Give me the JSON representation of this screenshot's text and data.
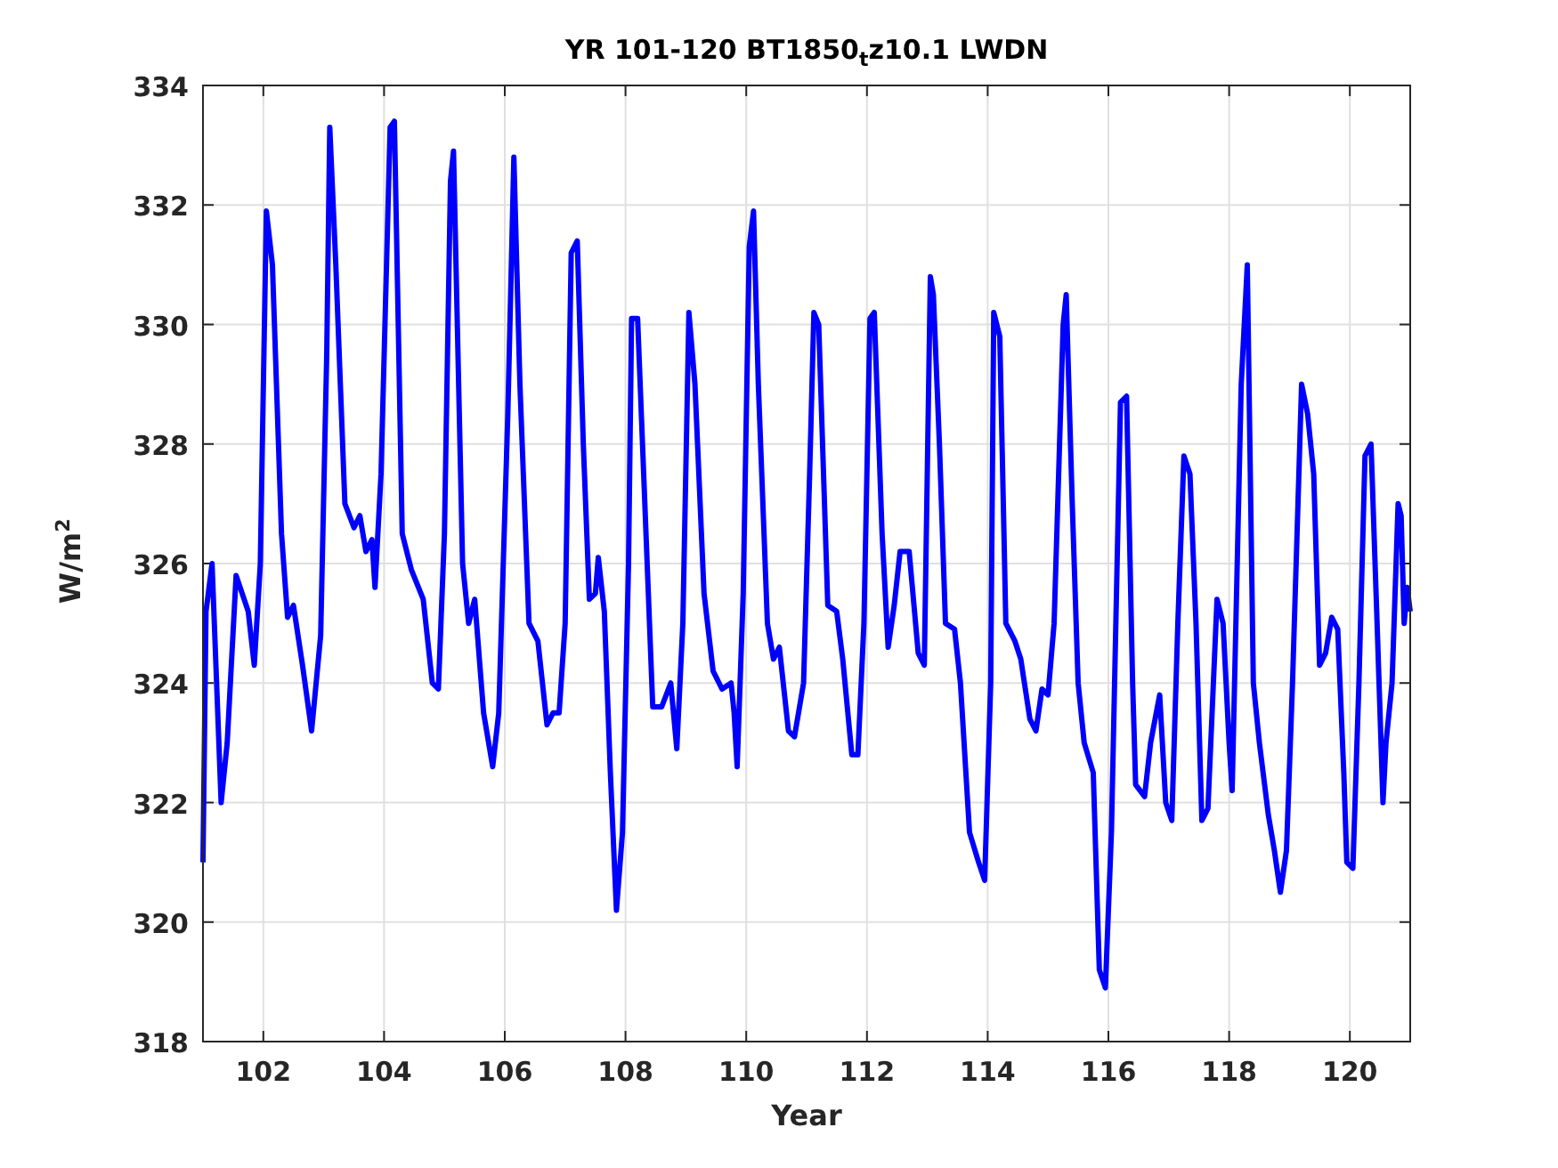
{
  "figure": {
    "chart_data": {
      "type": "line",
      "title": "YR 101-120 BT1850$_{t}$z10.1 LWDN",
      "xlabel": "Year",
      "ylabel": "W/m$^{2}$",
      "xlim": [
        101,
        121
      ],
      "ylim": [
        318,
        334
      ],
      "grid": true,
      "xticks": [
        102,
        104,
        106,
        108,
        110,
        112,
        114,
        116,
        118,
        120
      ],
      "yticks": [
        318,
        320,
        322,
        324,
        326,
        328,
        330,
        332,
        334
      ],
      "x": [
        101.0,
        101.05,
        101.15,
        101.3,
        101.4,
        101.55,
        101.75,
        101.85,
        101.95,
        102.05,
        102.15,
        102.3,
        102.4,
        102.5,
        102.65,
        102.8,
        102.95,
        103.05,
        103.1,
        103.2,
        103.35,
        103.5,
        103.6,
        103.7,
        103.8,
        103.85,
        103.95,
        104.1,
        104.17,
        104.3,
        104.45,
        104.65,
        104.8,
        104.9,
        105.0,
        105.1,
        105.15,
        105.3,
        105.4,
        105.5,
        105.65,
        105.8,
        105.9,
        106.05,
        106.15,
        106.25,
        106.4,
        106.55,
        106.7,
        106.8,
        106.9,
        107.0,
        107.1,
        107.2,
        107.3,
        107.4,
        107.5,
        107.55,
        107.65,
        107.75,
        107.85,
        107.95,
        108.05,
        108.1,
        108.2,
        108.3,
        108.45,
        108.6,
        108.75,
        108.85,
        108.95,
        109.05,
        109.15,
        109.3,
        109.45,
        109.6,
        109.75,
        109.8,
        109.85,
        109.95,
        110.05,
        110.12,
        110.2,
        110.35,
        110.45,
        110.55,
        110.7,
        110.8,
        110.95,
        111.05,
        111.12,
        111.2,
        111.35,
        111.5,
        111.6,
        111.75,
        111.85,
        111.95,
        112.05,
        112.12,
        112.25,
        112.35,
        112.45,
        112.55,
        112.7,
        112.85,
        112.95,
        113.05,
        113.1,
        113.2,
        113.3,
        113.45,
        113.55,
        113.7,
        113.85,
        113.95,
        114.05,
        114.1,
        114.2,
        114.3,
        114.45,
        114.55,
        114.7,
        114.8,
        114.9,
        115.0,
        115.1,
        115.25,
        115.3,
        115.4,
        115.5,
        115.6,
        115.75,
        115.85,
        115.95,
        116.05,
        116.2,
        116.3,
        116.4,
        116.45,
        116.6,
        116.7,
        116.85,
        116.95,
        117.05,
        117.15,
        117.25,
        117.35,
        117.45,
        117.55,
        117.65,
        117.8,
        117.9,
        118.0,
        118.05,
        118.2,
        118.3,
        118.4,
        118.5,
        118.65,
        118.75,
        118.85,
        118.95,
        119.05,
        119.2,
        119.3,
        119.4,
        119.5,
        119.6,
        119.7,
        119.8,
        119.9,
        119.95,
        120.05,
        120.15,
        120.25,
        120.35,
        120.45,
        120.55,
        120.6,
        120.7,
        120.8,
        120.85,
        120.9,
        120.95,
        121.0
      ],
      "series": [
        {
          "color": "#0000ff",
          "values": [
            321.0,
            325.2,
            326.0,
            322.0,
            323.0,
            325.8,
            325.2,
            324.3,
            326.0,
            331.9,
            331.0,
            326.5,
            325.1,
            325.3,
            324.3,
            323.2,
            324.8,
            329.5,
            333.3,
            331.0,
            327.0,
            326.6,
            326.8,
            326.2,
            326.4,
            325.6,
            327.5,
            333.3,
            333.4,
            326.5,
            325.9,
            325.4,
            324.0,
            323.9,
            326.5,
            332.4,
            332.9,
            326.0,
            325.0,
            325.4,
            323.5,
            322.6,
            323.5,
            328.5,
            332.8,
            329.0,
            325.0,
            324.7,
            323.3,
            323.5,
            323.5,
            325.0,
            331.2,
            331.4,
            328.0,
            325.4,
            325.5,
            326.1,
            325.2,
            322.5,
            320.2,
            321.5,
            326.0,
            330.1,
            330.1,
            327.5,
            323.6,
            323.6,
            324.0,
            322.9,
            325.0,
            330.2,
            329.0,
            325.5,
            324.2,
            323.9,
            324.0,
            323.5,
            322.6,
            325.5,
            331.3,
            331.9,
            329.0,
            325.0,
            324.4,
            324.6,
            323.2,
            323.1,
            324.0,
            327.5,
            330.2,
            330.0,
            325.3,
            325.2,
            324.4,
            322.8,
            322.8,
            325.0,
            330.1,
            330.2,
            326.5,
            324.6,
            325.3,
            326.2,
            326.2,
            324.5,
            324.3,
            330.8,
            330.5,
            328.0,
            325.0,
            324.9,
            324.0,
            321.5,
            321.0,
            320.7,
            324.0,
            330.2,
            329.8,
            325.0,
            324.7,
            324.4,
            323.4,
            323.2,
            323.9,
            323.8,
            325.0,
            330.0,
            330.5,
            327.0,
            324.0,
            323.0,
            322.5,
            319.2,
            318.9,
            321.5,
            328.7,
            328.8,
            324.0,
            322.3,
            322.1,
            323.0,
            323.8,
            322.0,
            321.7,
            325.0,
            327.8,
            327.5,
            325.0,
            321.7,
            321.9,
            325.4,
            325.0,
            323.0,
            322.2,
            329.0,
            331.0,
            324.0,
            323.0,
            321.8,
            321.2,
            320.5,
            321.2,
            324.0,
            329.0,
            328.5,
            327.5,
            324.3,
            324.5,
            325.1,
            324.9,
            322.5,
            321.0,
            320.9,
            324.0,
            327.8,
            328.0,
            325.0,
            322.0,
            323.0,
            324.0,
            327.0,
            326.8,
            325.0,
            325.6,
            325.2
          ]
        }
      ]
    }
  }
}
